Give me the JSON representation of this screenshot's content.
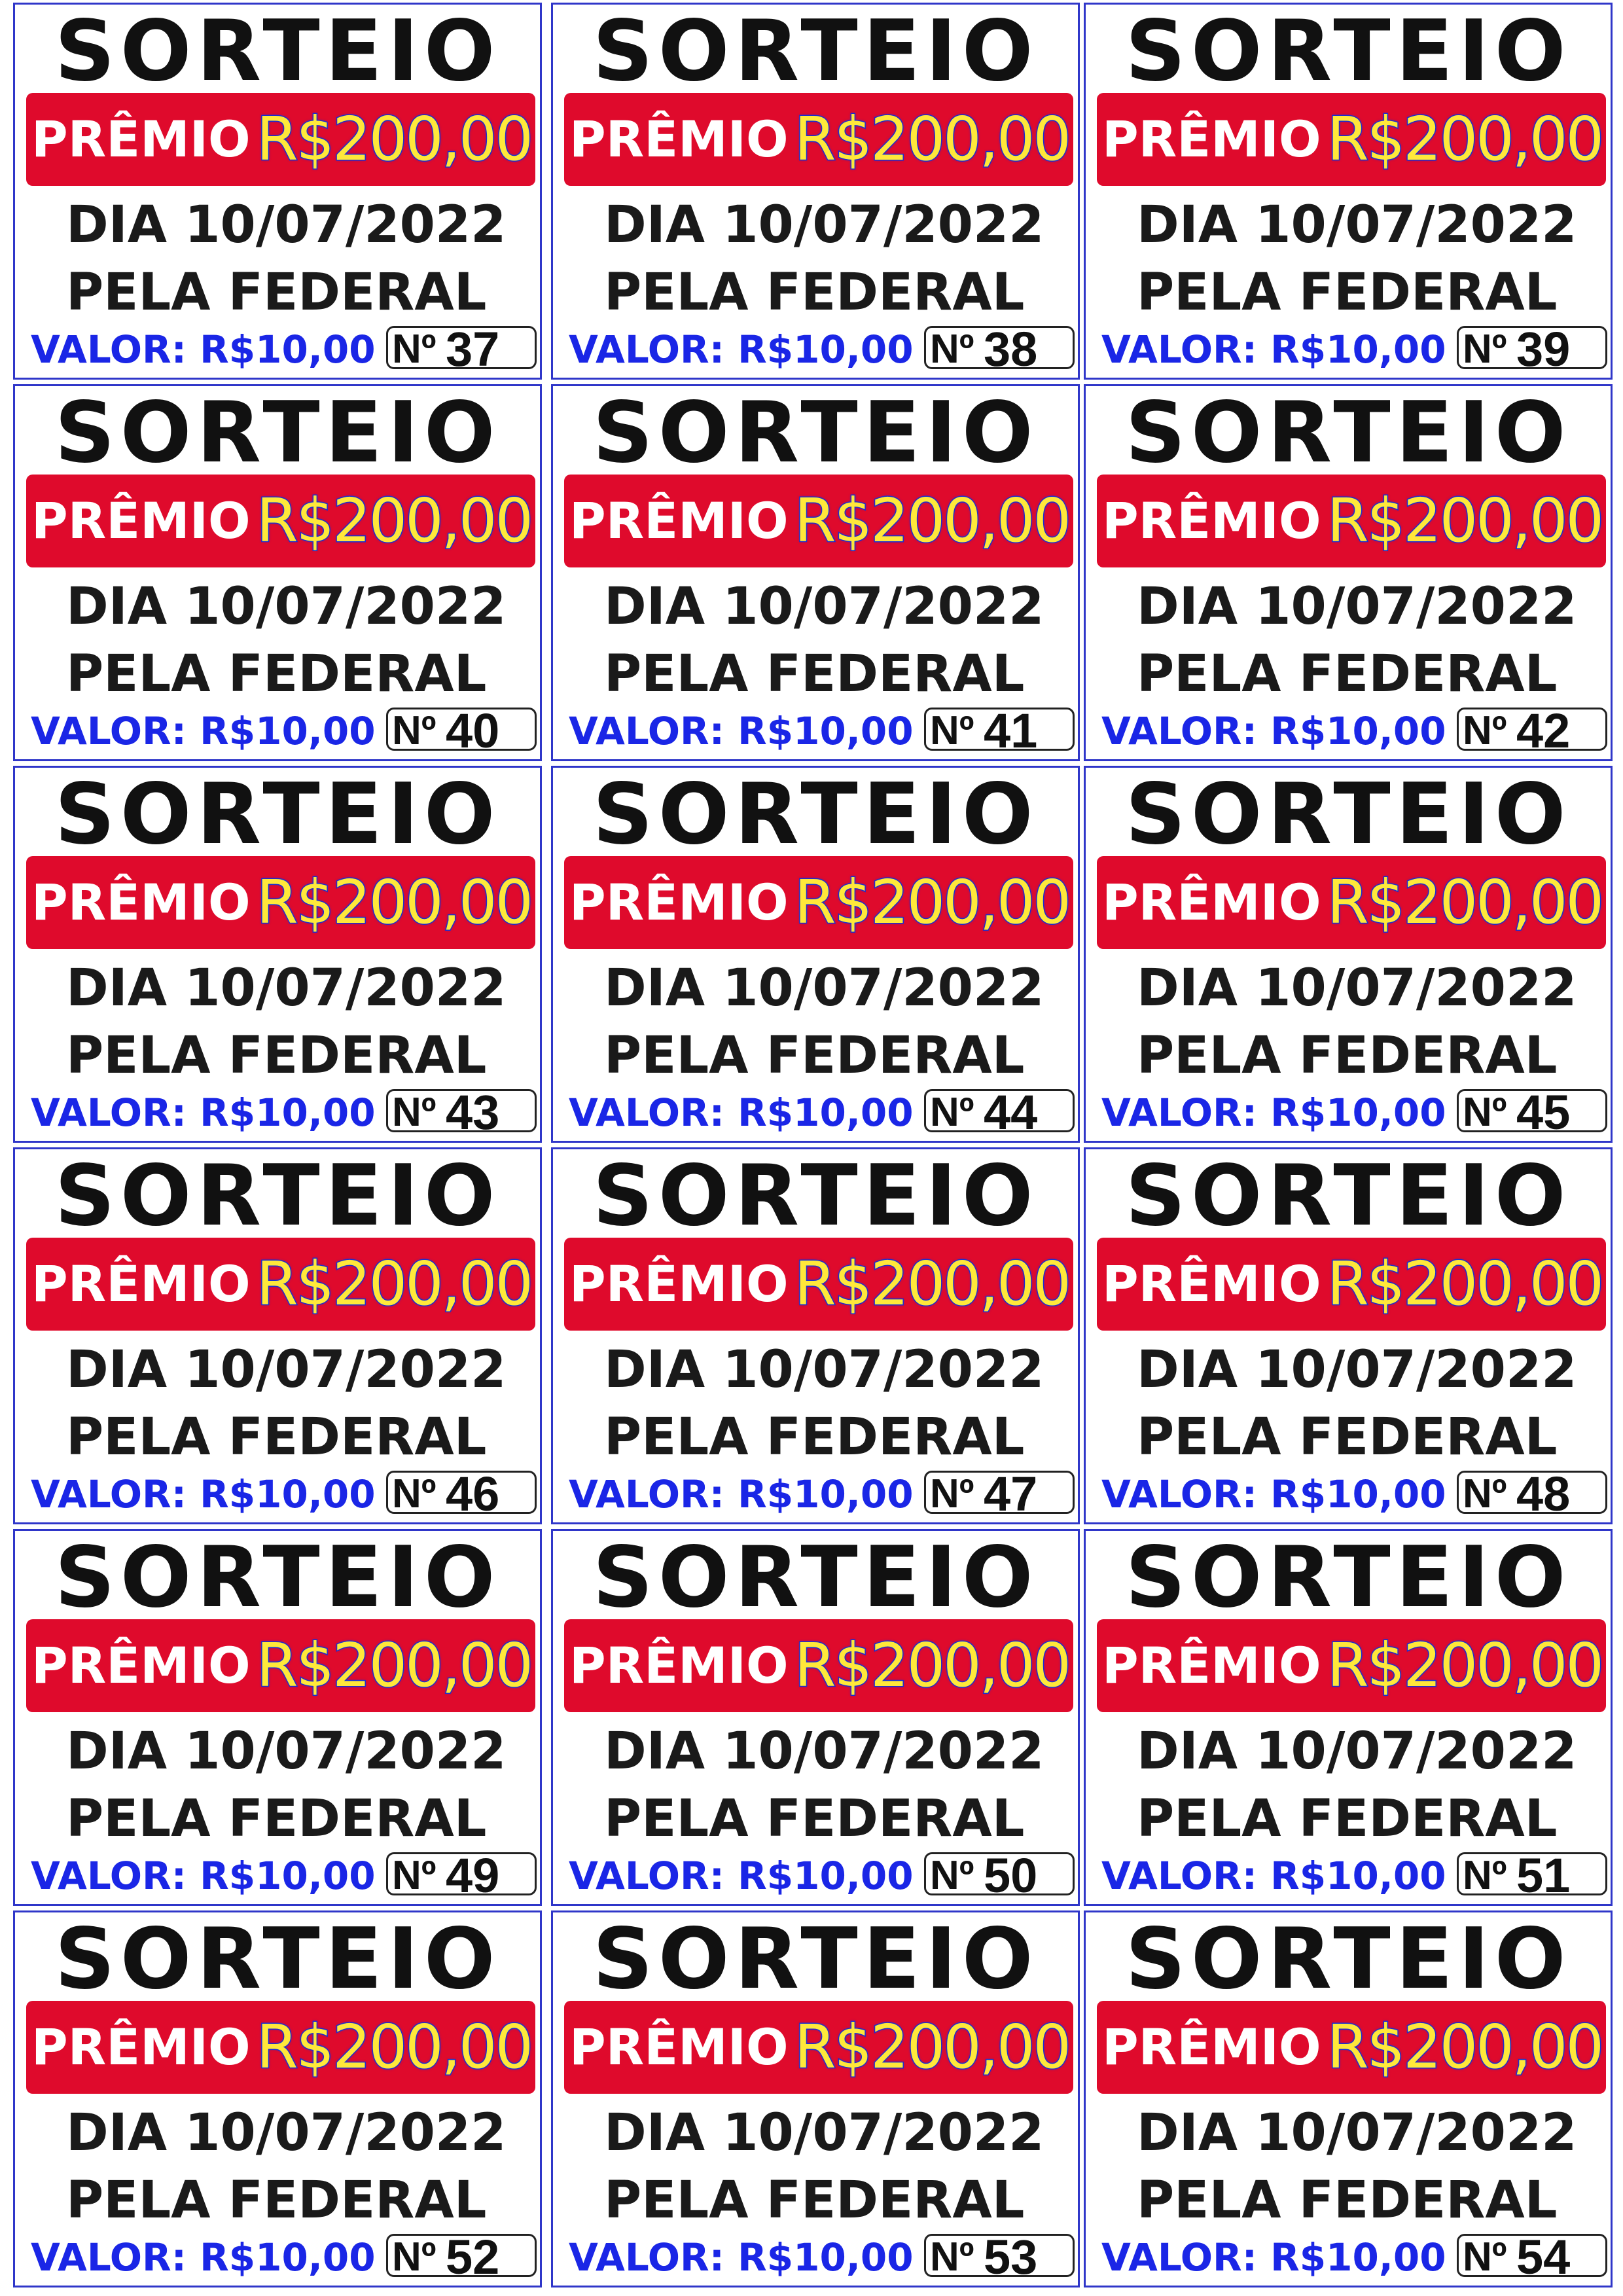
{
  "ticket_template": {
    "title": "SORTEIO",
    "prize_label": "PRÊMIO",
    "prize_value": "R$200,00",
    "date": "DIA 10/07/2022",
    "draw": "PELA FEDERAL",
    "price": "VALOR: R$10,00",
    "number_prefix": "Nº"
  },
  "tickets": [
    {
      "number": "37"
    },
    {
      "number": "38"
    },
    {
      "number": "39"
    },
    {
      "number": "40"
    },
    {
      "number": "41"
    },
    {
      "number": "42"
    },
    {
      "number": "43"
    },
    {
      "number": "44"
    },
    {
      "number": "45"
    },
    {
      "number": "46"
    },
    {
      "number": "47"
    },
    {
      "number": "48"
    },
    {
      "number": "49"
    },
    {
      "number": "50"
    },
    {
      "number": "51"
    },
    {
      "number": "52"
    },
    {
      "number": "53"
    },
    {
      "number": "54"
    }
  ],
  "colors": {
    "border": "#2f36c9",
    "prize_background": "#df0a2c",
    "prize_value_fill": "#ffe83a",
    "prize_value_outline": "#1a2fd0",
    "price_text": "#1a26e6",
    "text": "#1a1a1a"
  }
}
